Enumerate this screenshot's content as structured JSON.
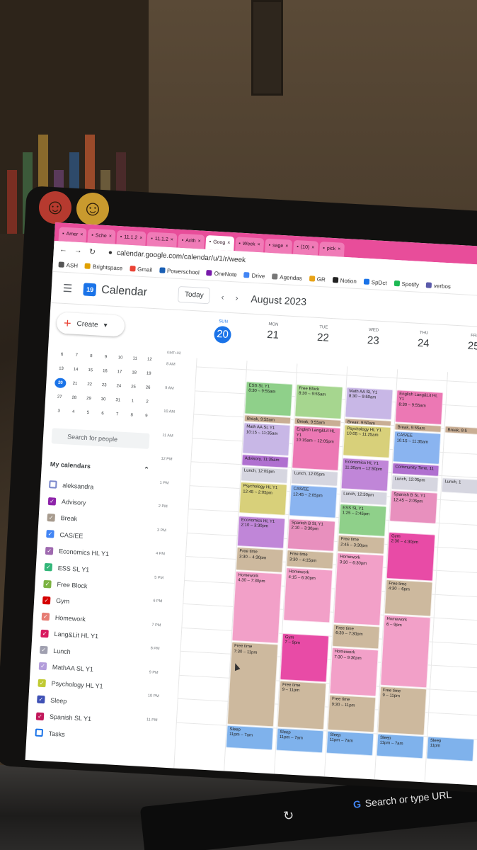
{
  "browser": {
    "tabs": [
      {
        "label": "Amer",
        "active": false
      },
      {
        "label": "Sche",
        "active": false
      },
      {
        "label": "11.1.2",
        "active": false
      },
      {
        "label": "11.1.2",
        "active": false
      },
      {
        "label": "Arith",
        "active": false
      },
      {
        "label": "Goog",
        "active": true
      },
      {
        "label": "Week",
        "active": false
      },
      {
        "label": "sage",
        "active": false
      },
      {
        "label": "(10)",
        "active": false
      },
      {
        "label": "pick",
        "active": false
      }
    ],
    "url": "calendar.google.com/calendar/u/1/r/week",
    "bookmarks": [
      "ASH",
      "Brightspace",
      "Gmail",
      "Powerschool",
      "OneNote",
      "Drive",
      "Agendas",
      "GR",
      "Notion",
      "SpDct",
      "Spotify",
      "verbos"
    ]
  },
  "calendar": {
    "app_title": "Calendar",
    "logo_day": "19",
    "today_label": "Today",
    "month_label": "August 2023",
    "create_label": "Create",
    "timezone": "GMT+02",
    "search_people_placeholder": "Search for people",
    "my_calendars_label": "My calendars",
    "days": [
      {
        "name": "SUN",
        "date": "20",
        "today": true
      },
      {
        "name": "MON",
        "date": "21"
      },
      {
        "name": "TUE",
        "date": "22"
      },
      {
        "name": "WED",
        "date": "23"
      },
      {
        "name": "THU",
        "date": "24"
      },
      {
        "name": "FRI",
        "date": "25"
      }
    ],
    "hours": [
      "8 AM",
      "9 AM",
      "10 AM",
      "11 AM",
      "12 PM",
      "1 PM",
      "2 PM",
      "3 PM",
      "4 PM",
      "5 PM",
      "6 PM",
      "7 PM",
      "8 PM",
      "9 PM",
      "10 PM",
      "11 PM"
    ]
  },
  "mini_calendar": {
    "weeks": [
      [
        "6",
        "7",
        "8",
        "9",
        "10",
        "11",
        "12"
      ],
      [
        "13",
        "14",
        "15",
        "16",
        "17",
        "18",
        "19"
      ],
      [
        "20",
        "21",
        "22",
        "23",
        "24",
        "25",
        "26"
      ],
      [
        "27",
        "28",
        "29",
        "30",
        "31",
        "1",
        "2"
      ],
      [
        "3",
        "4",
        "5",
        "6",
        "7",
        "8",
        "9"
      ]
    ],
    "selected": "20"
  },
  "calendars": [
    {
      "name": "aleksandra",
      "color": "#7986cb",
      "checked": false
    },
    {
      "name": "Advisory",
      "color": "#8e24aa",
      "checked": true
    },
    {
      "name": "Break",
      "color": "#a79b8e",
      "checked": true
    },
    {
      "name": "CAS/EE",
      "color": "#4285f4",
      "checked": true
    },
    {
      "name": "Economics HL Y1",
      "color": "#9e69af",
      "checked": true
    },
    {
      "name": "ESS SL Y1",
      "color": "#33b679",
      "checked": true
    },
    {
      "name": "Free Block",
      "color": "#7cb342",
      "checked": true
    },
    {
      "name": "Gym",
      "color": "#d50000",
      "checked": true
    },
    {
      "name": "Homework",
      "color": "#e67c73",
      "checked": true
    },
    {
      "name": "Lang&Lit HL Y1",
      "color": "#d81b60",
      "checked": true
    },
    {
      "name": "Lunch",
      "color": "#a0a0b0",
      "checked": true
    },
    {
      "name": "MathAA SL Y1",
      "color": "#b39ddb",
      "checked": true
    },
    {
      "name": "Psychology HL Y1",
      "color": "#c0ca33",
      "checked": true
    },
    {
      "name": "Sleep",
      "color": "#3f51b5",
      "checked": true
    },
    {
      "name": "Spanish SL Y1",
      "color": "#c2185b",
      "checked": true
    },
    {
      "name": "Tasks",
      "color": "#1a73e8",
      "checked": false
    }
  ],
  "events": [
    {
      "day": 1,
      "start": 8.5,
      "end": 9.92,
      "title": "ESS SL Y1",
      "time": "8:30 – 9:55am",
      "color": "#8fd08a"
    },
    {
      "day": 1,
      "start": 9.92,
      "end": 10.25,
      "title": "Break, 9:55am",
      "time": "",
      "color": "#c9ae94"
    },
    {
      "day": 1,
      "start": 10.25,
      "end": 11.58,
      "title": "Math AA SL Y1",
      "time": "10:15 – 11:35am",
      "color": "#c8b7e6"
    },
    {
      "day": 1,
      "start": 11.58,
      "end": 12.08,
      "title": "Advisory, 11:35am",
      "time": "",
      "color": "#b070d0"
    },
    {
      "day": 1,
      "start": 12.08,
      "end": 12.75,
      "title": "Lunch, 12:05pm",
      "time": "",
      "color": "#d6d6e0"
    },
    {
      "day": 1,
      "start": 12.75,
      "end": 14.08,
      "title": "Psychology HL Y1",
      "time": "12:45 – 2:05pm",
      "color": "#d8d07a"
    },
    {
      "day": 1,
      "start": 14.17,
      "end": 15.5,
      "title": "Economics HL Y1",
      "time": "2:10 – 3:30pm",
      "color": "#c086d8"
    },
    {
      "day": 1,
      "start": 15.5,
      "end": 16.5,
      "title": "Free time",
      "time": "3:30 – 4:30pm",
      "color": "#cdb99e"
    },
    {
      "day": 1,
      "start": 16.5,
      "end": 19.5,
      "title": "Homework",
      "time": "4:30 – 7:30pm",
      "color": "#f2a0c8"
    },
    {
      "day": 1,
      "start": 19.5,
      "end": 23.0,
      "title": "Free time",
      "time": "7:30 – 11pm",
      "color": "#cdb99e"
    },
    {
      "day": 1,
      "start": 23.0,
      "end": 24.0,
      "title": "Sleep",
      "time": "11pm – 7am",
      "color": "#7fb2ec"
    },
    {
      "day": 2,
      "start": 8.5,
      "end": 9.92,
      "title": "Free Block",
      "time": "8:30 – 9:55am",
      "color": "#a6d68f"
    },
    {
      "day": 2,
      "start": 9.92,
      "end": 10.25,
      "title": "Break, 9:55am",
      "time": "",
      "color": "#c9ae94"
    },
    {
      "day": 2,
      "start": 10.25,
      "end": 12.08,
      "title": "English Lang&Lit HL Y1",
      "time": "10:15am – 12:05pm",
      "color": "#ec78b4"
    },
    {
      "day": 2,
      "start": 12.08,
      "end": 12.75,
      "title": "Lunch, 12:05pm",
      "time": "",
      "color": "#d6d6e0"
    },
    {
      "day": 2,
      "start": 12.75,
      "end": 14.08,
      "title": "CAS/EE",
      "time": "12:45 – 2:05pm",
      "color": "#8ab4f0"
    },
    {
      "day": 2,
      "start": 14.17,
      "end": 15.5,
      "title": "Spanish B SL Y1",
      "time": "2:10 – 3:30pm",
      "color": "#e890be"
    },
    {
      "day": 2,
      "start": 15.5,
      "end": 16.25,
      "title": "Free time",
      "time": "3:30 – 4:15pm",
      "color": "#cdb99e"
    },
    {
      "day": 2,
      "start": 16.25,
      "end": 18.5,
      "title": "Homework",
      "time": "4:15 – 6:30pm",
      "color": "#f2a0c8"
    },
    {
      "day": 2,
      "start": 19.0,
      "end": 21.0,
      "title": "Gym",
      "time": "7 – 9pm",
      "color": "#e84ba6"
    },
    {
      "day": 2,
      "start": 21.0,
      "end": 23.0,
      "title": "Free time",
      "time": "9 – 11pm",
      "color": "#cdb99e"
    },
    {
      "day": 2,
      "start": 23.0,
      "end": 24.0,
      "title": "Sleep",
      "time": "11pm – 7am",
      "color": "#7fb2ec"
    },
    {
      "day": 3,
      "start": 8.5,
      "end": 9.83,
      "title": "Math AA SL Y1",
      "time": "8:30 – 9:50am",
      "color": "#c8b7e6"
    },
    {
      "day": 3,
      "start": 9.83,
      "end": 10.08,
      "title": "Break, 9:50am",
      "time": "",
      "color": "#c9ae94"
    },
    {
      "day": 3,
      "start": 10.08,
      "end": 11.42,
      "title": "Psychology HL Y1",
      "time": "10:05 – 11:25am",
      "color": "#d8d07a"
    },
    {
      "day": 3,
      "start": 11.5,
      "end": 12.83,
      "title": "Economics HL Y1",
      "time": "11:30am – 12:50pm",
      "color": "#c086d8"
    },
    {
      "day": 3,
      "start": 12.83,
      "end": 13.42,
      "title": "Lunch, 12:50pm",
      "time": "",
      "color": "#d6d6e0"
    },
    {
      "day": 3,
      "start": 13.42,
      "end": 14.75,
      "title": "ESS SL Y1",
      "time": "1:25 – 2:45pm",
      "color": "#8fd08a"
    },
    {
      "day": 3,
      "start": 14.75,
      "end": 15.5,
      "title": "Free time",
      "time": "2:45 – 3:30pm",
      "color": "#cdb99e"
    },
    {
      "day": 3,
      "start": 15.5,
      "end": 18.5,
      "title": "Homework",
      "time": "3:30 – 6:30pm",
      "color": "#f2a0c8"
    },
    {
      "day": 3,
      "start": 18.5,
      "end": 19.5,
      "title": "Free time",
      "time": "6:30 – 7:30pm",
      "color": "#cdb99e"
    },
    {
      "day": 3,
      "start": 19.5,
      "end": 21.5,
      "title": "Homework",
      "time": "7:30 – 9:30pm",
      "color": "#f2a0c8"
    },
    {
      "day": 3,
      "start": 21.5,
      "end": 23.0,
      "title": "Free time",
      "time": "9:30 – 11pm",
      "color": "#cdb99e"
    },
    {
      "day": 3,
      "start": 23.0,
      "end": 24.0,
      "title": "Sleep",
      "time": "11pm – 7am",
      "color": "#7fb2ec"
    },
    {
      "day": 4,
      "start": 8.5,
      "end": 9.92,
      "title": "English Lang&Lit HL Y1",
      "time": "8:30 – 9:55am",
      "color": "#ec78b4"
    },
    {
      "day": 4,
      "start": 9.92,
      "end": 10.25,
      "title": "Break, 9:55am",
      "time": "",
      "color": "#c9ae94"
    },
    {
      "day": 4,
      "start": 10.25,
      "end": 11.58,
      "title": "CAS/EE",
      "time": "10:15 – 11:35am",
      "color": "#8ab4f0"
    },
    {
      "day": 4,
      "start": 11.58,
      "end": 12.08,
      "title": "Community Time, 11",
      "time": "",
      "color": "#b070d0"
    },
    {
      "day": 4,
      "start": 12.08,
      "end": 12.75,
      "title": "Lunch, 12:05pm",
      "time": "",
      "color": "#d6d6e0"
    },
    {
      "day": 4,
      "start": 12.75,
      "end": 14.08,
      "title": "Spanish B SL Y1",
      "time": "12:45 – 2:05pm",
      "color": "#e890be"
    },
    {
      "day": 4,
      "start": 14.5,
      "end": 16.5,
      "title": "Gym",
      "time": "2:30 – 4:30pm",
      "color": "#e84ba6"
    },
    {
      "day": 4,
      "start": 16.5,
      "end": 18.0,
      "title": "Free time",
      "time": "4:30 – 6pm",
      "color": "#cdb99e"
    },
    {
      "day": 4,
      "start": 18.0,
      "end": 21.0,
      "title": "Homework",
      "time": "6 – 9pm",
      "color": "#f2a0c8"
    },
    {
      "day": 4,
      "start": 21.0,
      "end": 23.0,
      "title": "Free time",
      "time": "9 – 11pm",
      "color": "#cdb99e"
    },
    {
      "day": 4,
      "start": 23.0,
      "end": 24.0,
      "title": "Sleep",
      "time": "11pm – 7am",
      "color": "#7fb2ec"
    },
    {
      "day": 5,
      "start": 9.92,
      "end": 10.25,
      "title": "Break, 9:5",
      "time": "",
      "color": "#c9ae94"
    },
    {
      "day": 5,
      "start": 12.08,
      "end": 12.75,
      "title": "Lunch, 1",
      "time": "",
      "color": "#d6d6e0"
    },
    {
      "day": 5,
      "start": 23.0,
      "end": 24.0,
      "title": "Sleep",
      "time": "11pm",
      "color": "#7fb2ec"
    }
  ],
  "touchbar": {
    "search_label": "Search or type URL"
  }
}
